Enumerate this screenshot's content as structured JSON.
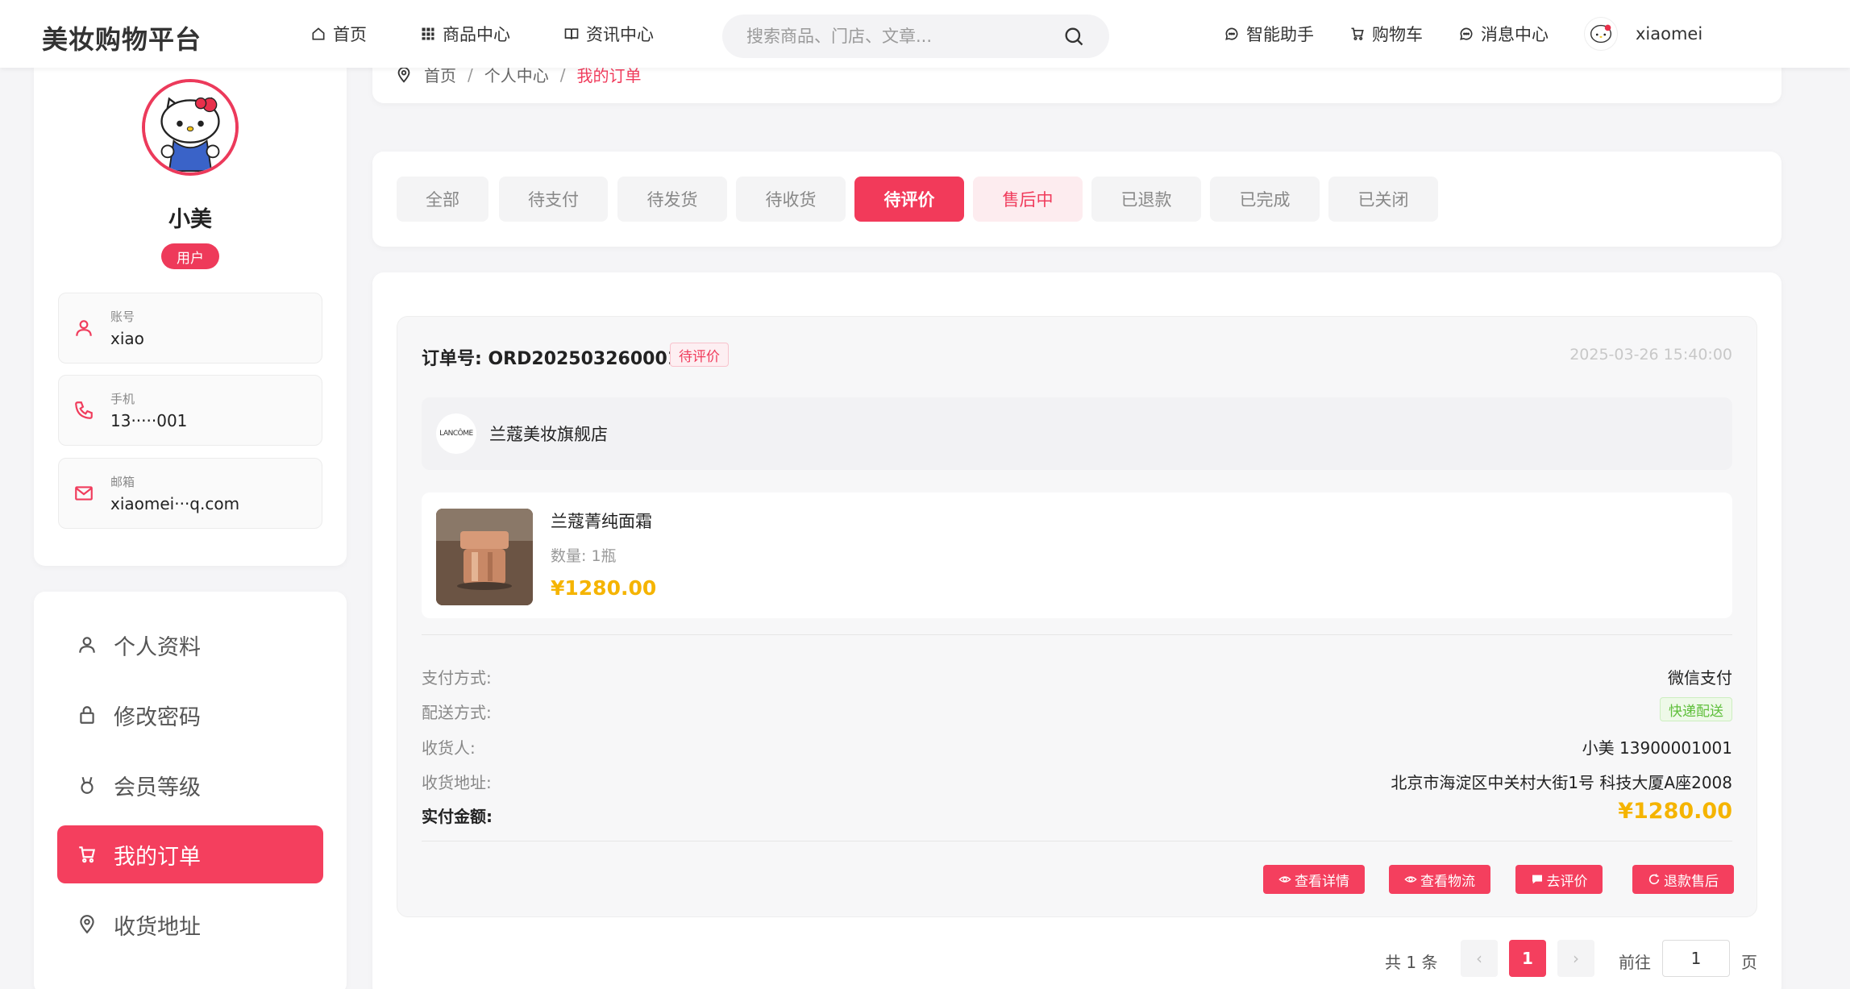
{
  "header": {
    "logo": "美妆购物平台",
    "nav": [
      {
        "label": "首页",
        "icon": "home-icon"
      },
      {
        "label": "商品中心",
        "icon": "grid-icon"
      },
      {
        "label": "资讯中心",
        "icon": "book-icon"
      }
    ],
    "search_placeholder": "搜索商品、门店、文章...",
    "right_nav": [
      {
        "label": "智能助手",
        "icon": "chat-icon"
      },
      {
        "label": "购物车",
        "icon": "cart-icon"
      },
      {
        "label": "消息中心",
        "icon": "message-icon"
      }
    ],
    "username": "xiaomei"
  },
  "profile": {
    "name": "小美",
    "role": "用户",
    "fields": [
      {
        "label": "账号",
        "value": "xiao"
      },
      {
        "label": "手机",
        "value": "13·····001"
      },
      {
        "label": "邮箱",
        "value": "xiaomei···q.com"
      }
    ]
  },
  "menu": [
    {
      "label": "个人资料",
      "icon": "user-icon",
      "active": false
    },
    {
      "label": "修改密码",
      "icon": "lock-icon",
      "active": false
    },
    {
      "label": "会员等级",
      "icon": "medal-icon",
      "active": false
    },
    {
      "label": "我的订单",
      "icon": "cart-icon",
      "active": true
    },
    {
      "label": "收货地址",
      "icon": "location-icon",
      "active": false
    }
  ],
  "breadcrumb": [
    "首页",
    "个人中心",
    "我的订单"
  ],
  "tabs": [
    "全部",
    "待支付",
    "待发货",
    "待收货",
    "待评价",
    "售后中",
    "已退款",
    "已完成",
    "已关闭"
  ],
  "active_tab": "待评价",
  "order": {
    "id_label": "订单号:",
    "id": "ORD202503260001",
    "status": "待评价",
    "time": "2025-03-26 15:40:00",
    "shop_logo": "LANCÔME",
    "shop_name": "兰蔻美妆旗舰店",
    "product_title": "兰蔻菁纯面霜",
    "product_qty": "数量: 1瓶",
    "product_price": "¥1280.00",
    "rows": [
      {
        "label": "支付方式:",
        "value": "微信支付"
      },
      {
        "label": "配送方式:",
        "value": "快递配送"
      },
      {
        "label": "收货人:",
        "value": "小美 13900001001"
      },
      {
        "label": "收货地址:",
        "value": "北京市海淀区中关村大街1号 科技大厦A座2008"
      }
    ],
    "total_label": "实付金额:",
    "total_value": "¥1280.00",
    "actions": [
      "查看详情",
      "查看物流",
      "去评价",
      "退款售后"
    ]
  },
  "pagination": {
    "total": "共 1 条",
    "prev": "‹",
    "current": "1",
    "next": "›",
    "goto": "前往",
    "input_value": "1",
    "unit": "页"
  },
  "colors": {
    "accent": "#f43f5e",
    "price": "#f5b400",
    "success": "#5fbf3b"
  }
}
